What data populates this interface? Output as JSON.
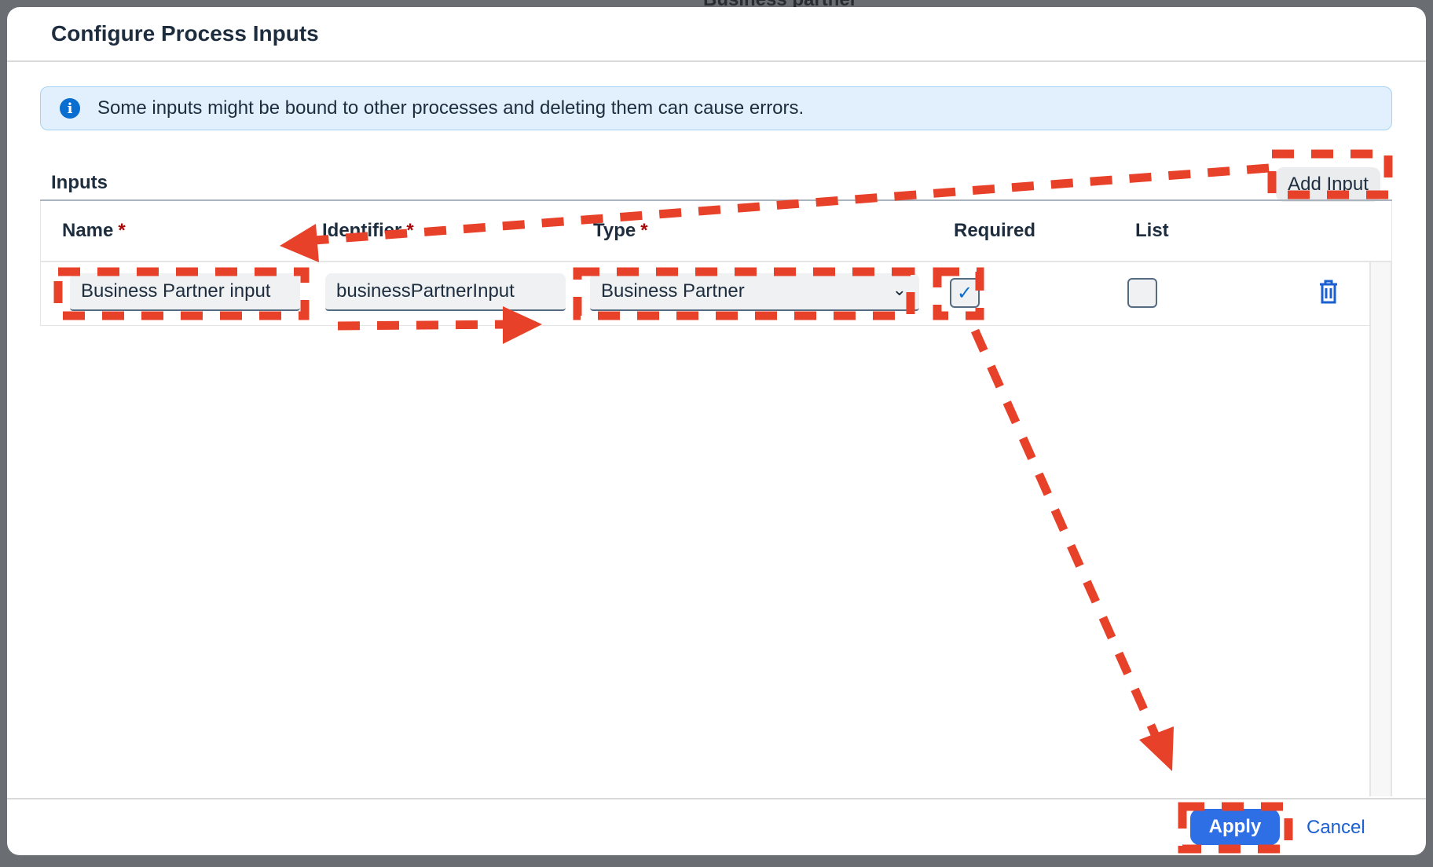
{
  "background": {
    "partial_text": "Business partner"
  },
  "dialog": {
    "title": "Configure Process Inputs",
    "info_message": "Some inputs might be bound to other processes and deleting them can cause errors.",
    "section_title": "Inputs",
    "add_input_label": "Add Input",
    "columns": {
      "name": "Name",
      "identifier": "Identifier",
      "type": "Type",
      "required": "Required",
      "list": "List"
    },
    "required_marker": "*",
    "rows": [
      {
        "name": "Business Partner input",
        "identifier": "businessPartnerInput",
        "type": "Business Partner",
        "required": true,
        "list": false
      }
    ],
    "apply_label": "Apply",
    "cancel_label": "Cancel"
  },
  "colors": {
    "accent": "#2e6fe5",
    "annotation": "#e8412a",
    "info_bg": "#e1f0fc"
  }
}
